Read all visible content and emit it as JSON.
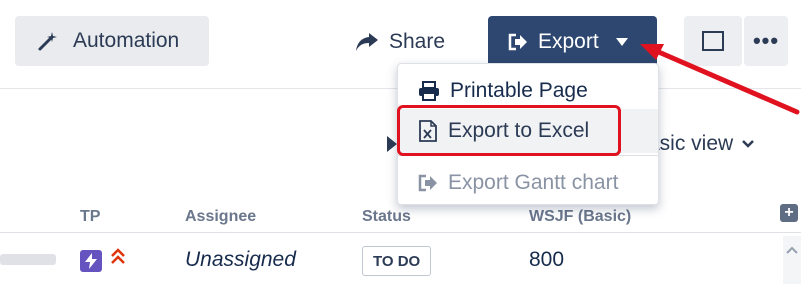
{
  "toolbar": {
    "automation_label": "Automation",
    "share_label": "Share",
    "export_label": "Export",
    "more_label": "•••"
  },
  "export_menu": {
    "items": [
      {
        "label": "Printable Page",
        "icon": "printer-icon"
      },
      {
        "label": "Export to Excel",
        "icon": "excel-file-icon"
      },
      {
        "label": "Export Gantt chart",
        "icon": "export-icon"
      }
    ]
  },
  "view": {
    "label": "asic view"
  },
  "table": {
    "columns": [
      "TP",
      "Assignee",
      "Status",
      "WSJF (Basic)"
    ],
    "rows": [
      {
        "tp_icon": "lightning-icon",
        "priority_icon": "highest-priority-icon",
        "assignee": "Unassigned",
        "status": "TO DO",
        "wsjf": "800"
      }
    ]
  },
  "colors": {
    "export_button": "#2d4770",
    "annotation_red": "#e0121f",
    "tp_icon_bg": "#6554c0"
  }
}
